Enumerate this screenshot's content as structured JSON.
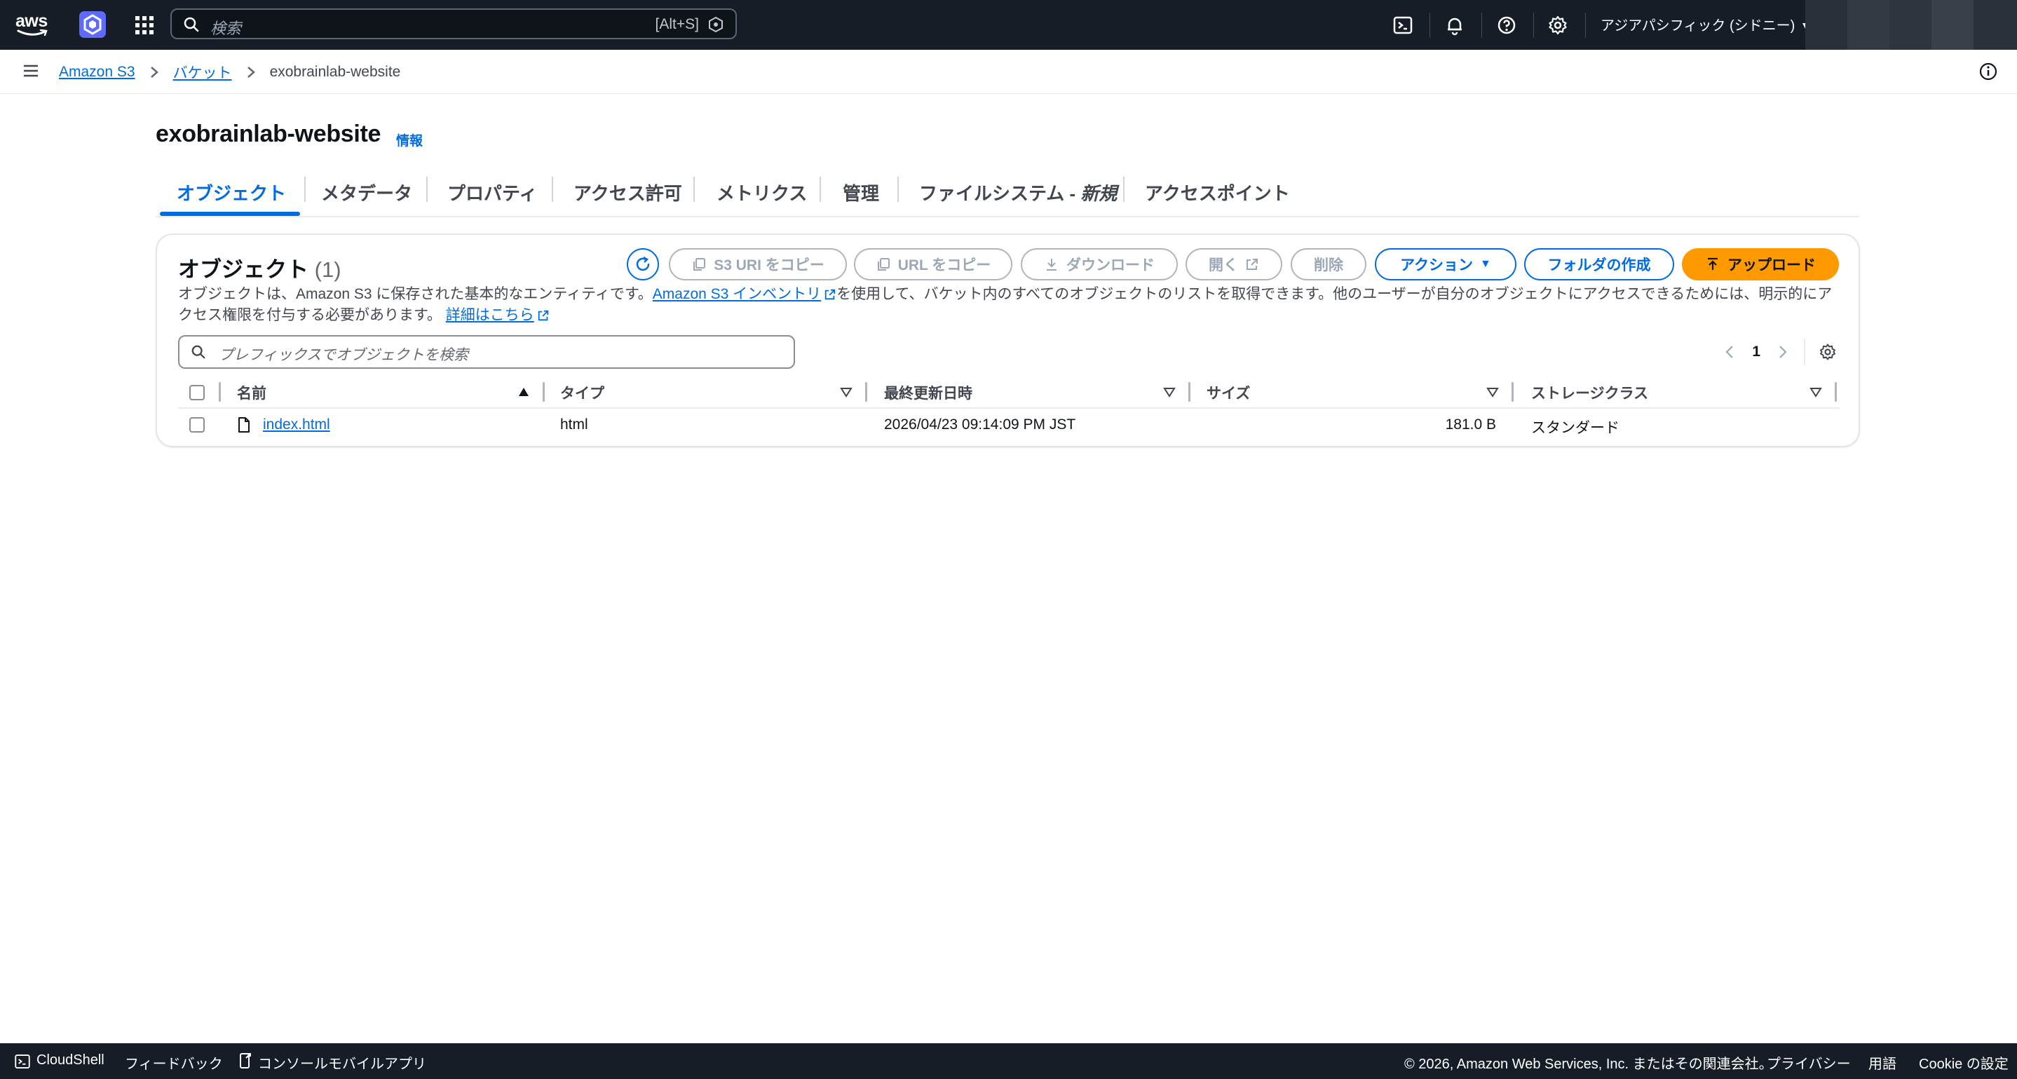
{
  "nav": {
    "brand": "aws",
    "search_placeholder": "検索",
    "search_shortcut": "[Alt+S]",
    "region": "アジアパシフィック (シドニー)",
    "icons": [
      "cloudshell-icon",
      "bell-icon",
      "help-icon",
      "gear-icon"
    ]
  },
  "breadcrumb": {
    "items": [
      "Amazon S3",
      "バケット"
    ],
    "current": "exobrainlab-website"
  },
  "page": {
    "title": "exobrainlab-website",
    "info": "情報"
  },
  "tabs": [
    {
      "label": "オブジェクト",
      "active": true
    },
    {
      "label": "メタデータ"
    },
    {
      "label": "プロパティ"
    },
    {
      "label": "アクセス許可"
    },
    {
      "label": "メトリクス"
    },
    {
      "label": "管理"
    },
    {
      "label": "ファイルシステム - ",
      "suffix": "新規"
    },
    {
      "label": "アクセスポイント"
    }
  ],
  "objects": {
    "title": "オブジェクト",
    "count": "(1)",
    "buttons": {
      "copy_s3_uri": "S3 URI をコピー",
      "copy_url": "URL をコピー",
      "download": "ダウンロード",
      "open": "開く",
      "delete": "削除",
      "actions": "アクション",
      "create_folder": "フォルダの作成",
      "upload": "アップロード"
    },
    "description_1": "オブジェクトは、Amazon S3 に保存された基本的なエンティティです。",
    "inventory_link": "Amazon S3 インベントリ",
    "description_2": "を使用して、バケット内のすべてのオブジェクトのリストを取得できます。他のユーザーが自分のオブジェクトにアクセスできるためには、明示的にアクセス権限を付与する必要があります。",
    "learn_more": "詳細はこちら",
    "filter_placeholder": "プレフィックスでオブジェクトを検索",
    "page": "1",
    "columns": [
      "名前",
      "タイプ",
      "最終更新日時",
      "サイズ",
      "ストレージクラス"
    ],
    "rows": [
      {
        "name": "index.html",
        "type": "html",
        "modified": "2026/04/23 09:14:09 PM JST",
        "size": "181.0 B",
        "storage_class": "スタンダード"
      }
    ]
  },
  "footer": {
    "cloudshell": "CloudShell",
    "feedback": "フィードバック",
    "mobile_app": "コンソールモバイルアプリ",
    "copyright": "© 2026, Amazon Web Services, Inc. またはその関連会社。",
    "privacy": "プライバシー",
    "terms": "用語",
    "cookie": "Cookie の設定"
  },
  "colors": {
    "nav_bg": "#161d26",
    "link": "#006ce0",
    "primary_action": "#ff9900",
    "text": "#0f141a"
  }
}
